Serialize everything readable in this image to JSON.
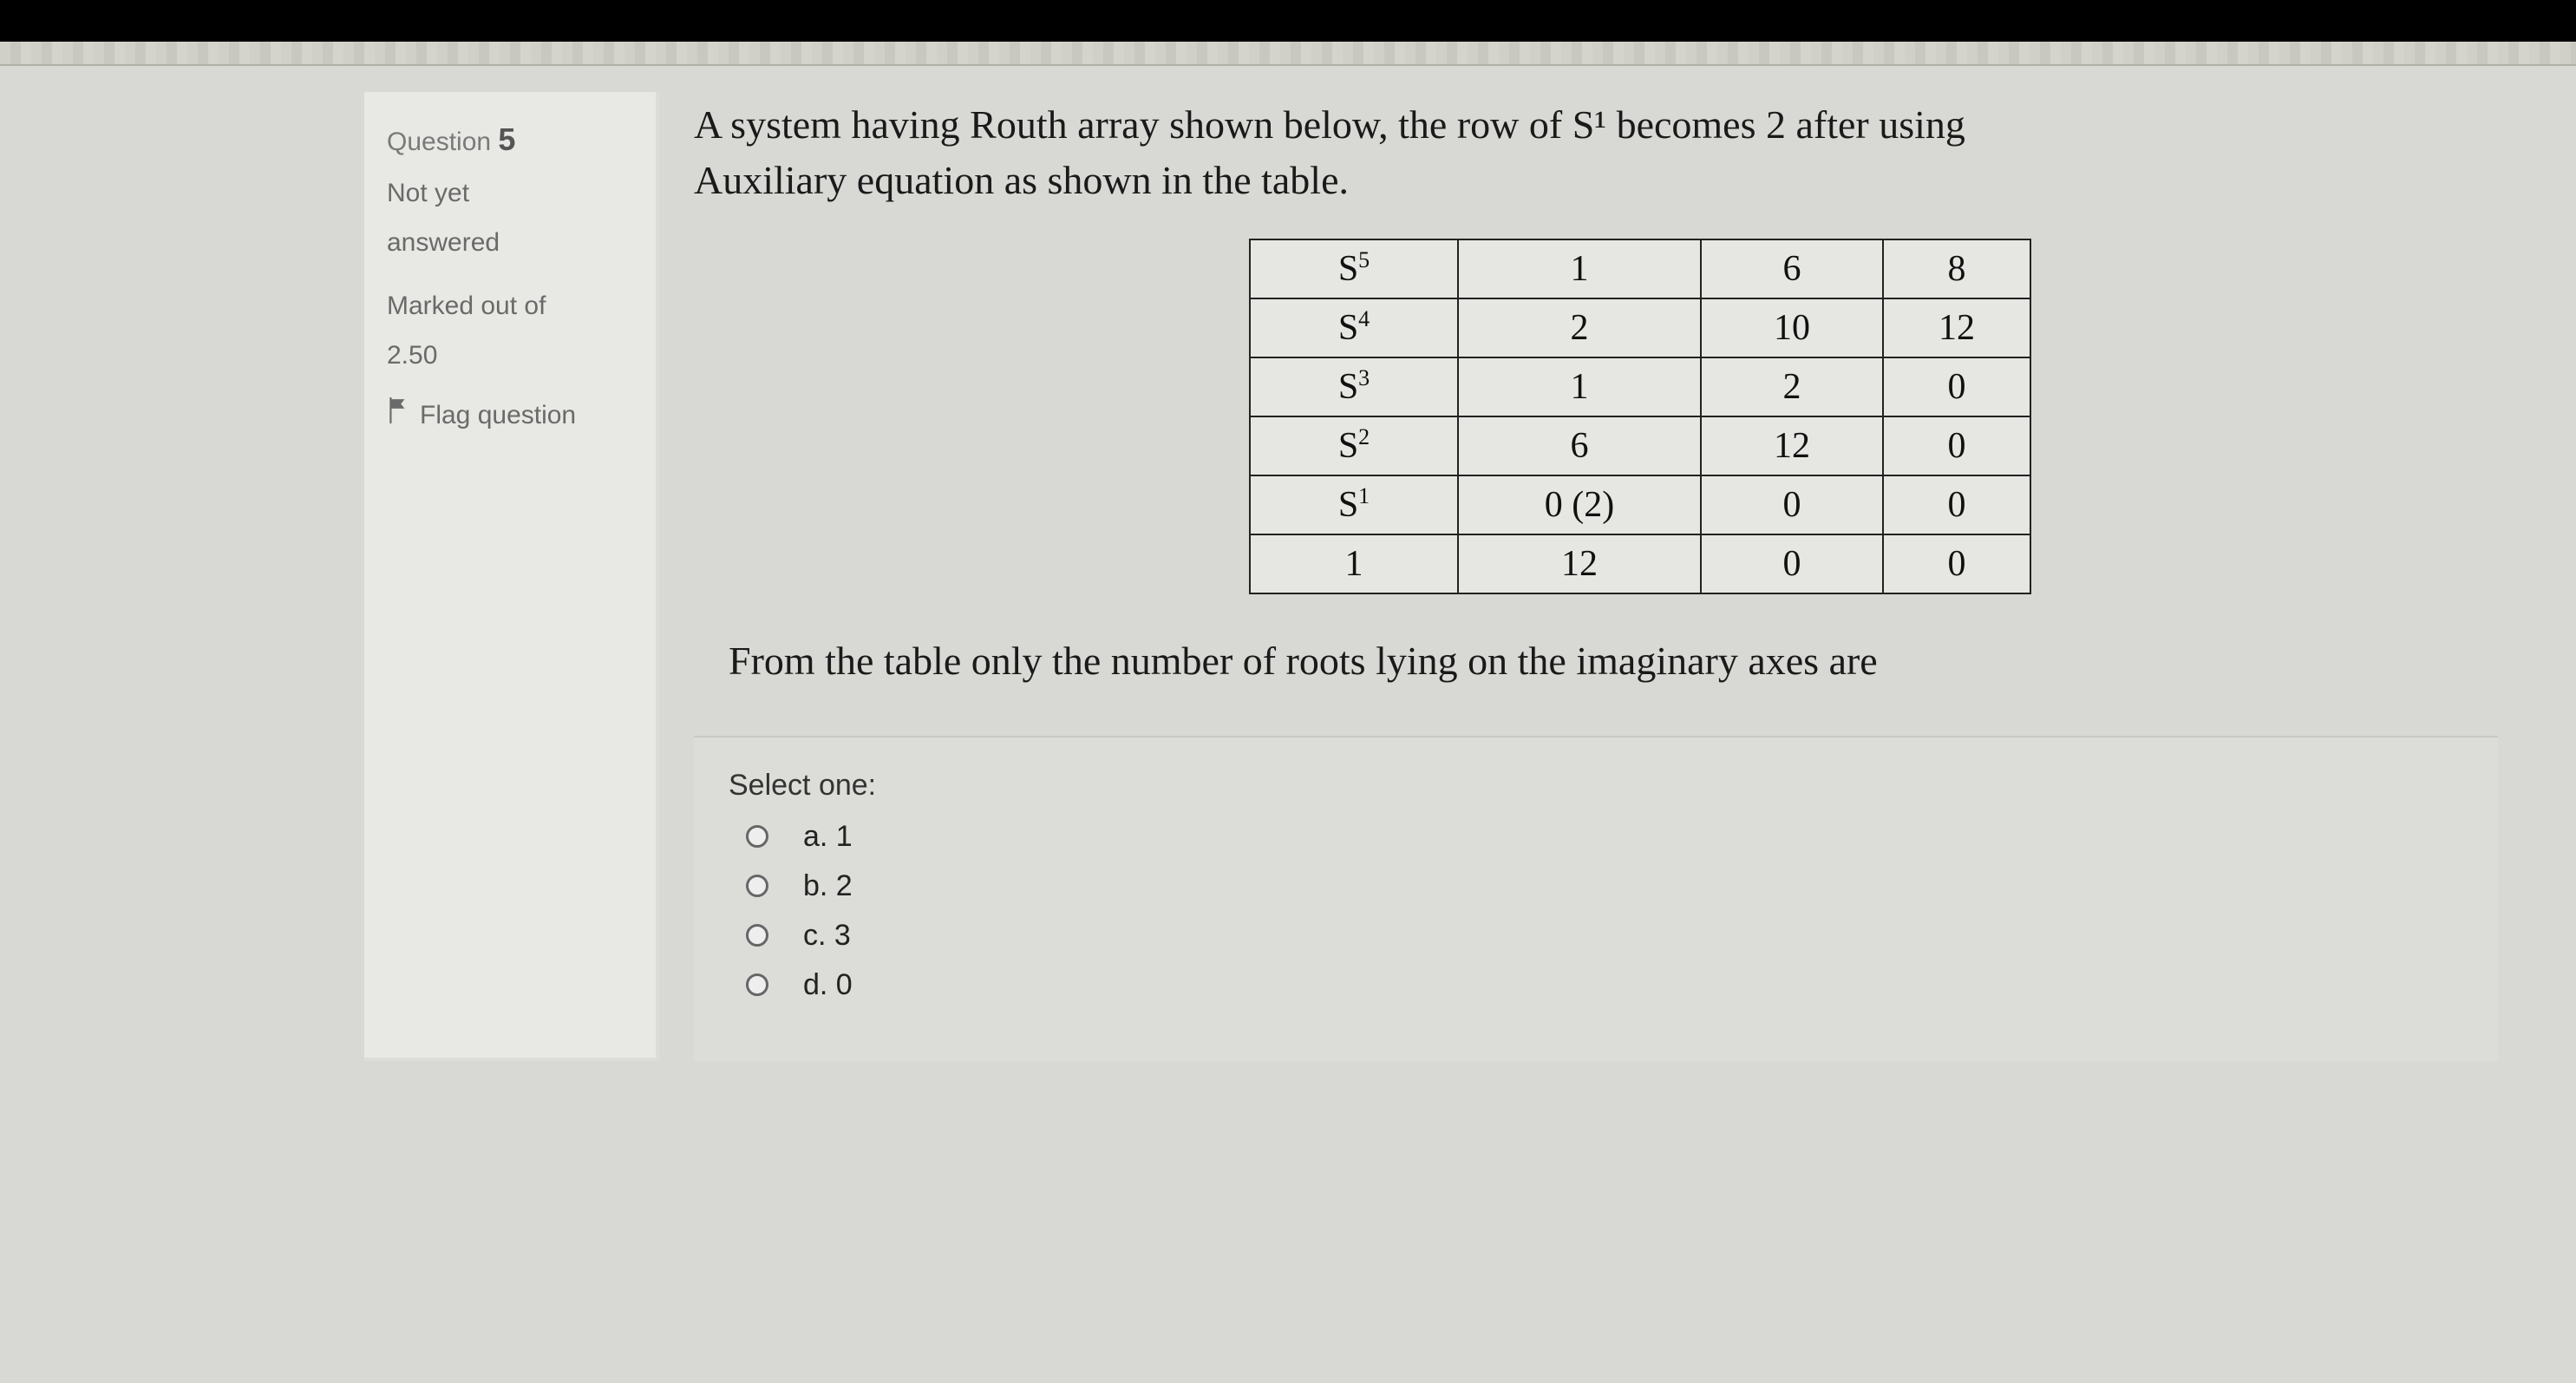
{
  "sidebar": {
    "question_label": "Question",
    "question_number": "5",
    "status1": "Not yet",
    "status2": "answered",
    "marked_label": "Marked out of",
    "marked_value": "2.50",
    "flag_label": "Flag question"
  },
  "stem": {
    "line1": "A system having Routh array shown below, the row of S¹ becomes 2 after using",
    "line2": "Auxiliary equation as shown in the table.",
    "tail": "From the table only the number of roots lying on the imaginary axes are"
  },
  "chart_data": {
    "type": "table",
    "title": "Routh array",
    "rows": [
      {
        "power": "S5",
        "c1": "1",
        "c2": "6",
        "c3": "8"
      },
      {
        "power": "S4",
        "c1": "2",
        "c2": "10",
        "c3": "12"
      },
      {
        "power": "S3",
        "c1": "1",
        "c2": "2",
        "c3": "0"
      },
      {
        "power": "S2",
        "c1": "6",
        "c2": "12",
        "c3": "0"
      },
      {
        "power": "S1",
        "c1": "0 (2)",
        "c2": "0",
        "c3": "0"
      },
      {
        "power": "1",
        "c1": "12",
        "c2": "0",
        "c3": "0"
      }
    ]
  },
  "answers": {
    "prompt": "Select one:",
    "options": [
      {
        "key": "a",
        "text": "a. 1"
      },
      {
        "key": "b",
        "text": "b. 2"
      },
      {
        "key": "c",
        "text": "c. 3"
      },
      {
        "key": "d",
        "text": "d. 0"
      }
    ]
  }
}
